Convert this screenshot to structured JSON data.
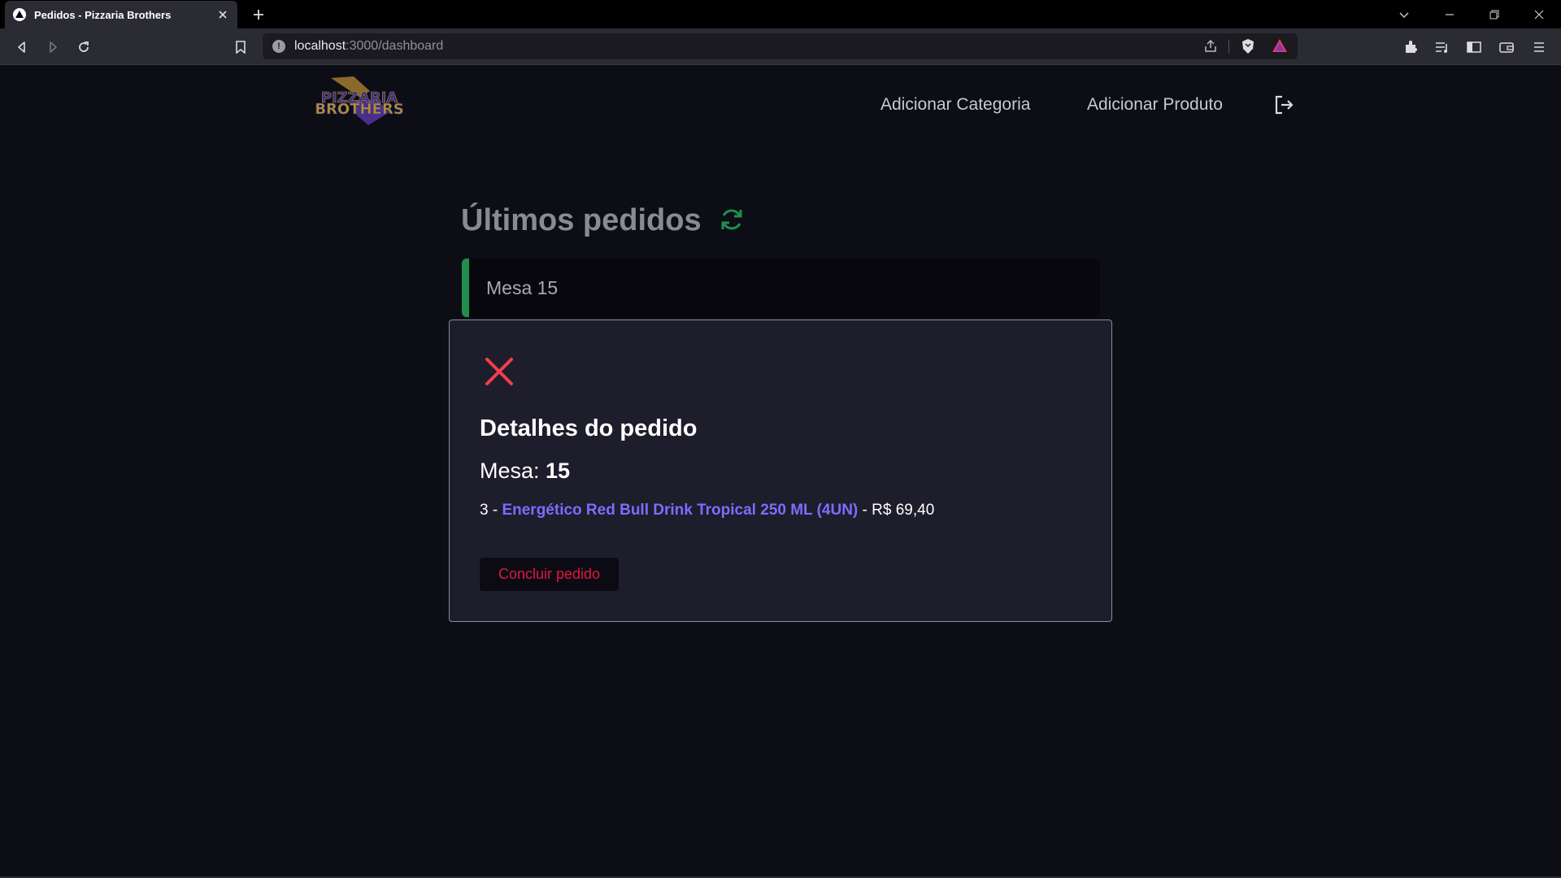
{
  "browser": {
    "tab_title": "Pedidos - Pizzaria Brothers",
    "url_host": "localhost",
    "url_path": ":3000/dashboard"
  },
  "header": {
    "logo_line1": "PIZZARIA",
    "logo_line2": "BROTHERS",
    "nav_add_category": "Adicionar Categoria",
    "nav_add_product": "Adicionar Produto"
  },
  "main": {
    "title": "Últimos pedidos",
    "orders": [
      {
        "label": "Mesa 15",
        "status_color": "#1f8f4e"
      }
    ]
  },
  "modal": {
    "title": "Detalhes do pedido",
    "table_label": "Mesa: ",
    "table_number": "15",
    "items": [
      {
        "amount": "3 - ",
        "name": "Energético Red Bull Drink Tropical 250 ML (4UN)",
        "price": " - R$ 69,40"
      }
    ],
    "finish_button": "Concluir pedido"
  },
  "colors": {
    "accent_green": "#1f8f4e",
    "accent_red": "#e0183d",
    "accent_purple": "#7f6bff",
    "background": "#0d0d16"
  }
}
